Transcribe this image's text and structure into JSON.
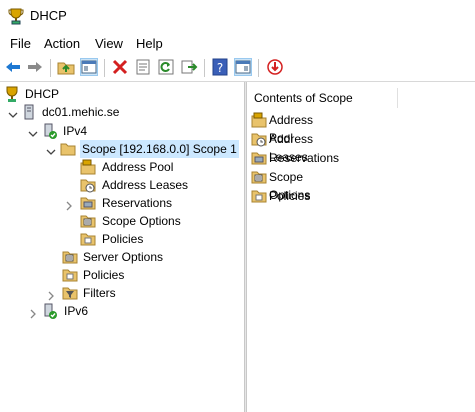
{
  "window": {
    "title": "DHCP"
  },
  "menu": [
    "File",
    "Action",
    "View",
    "Help"
  ],
  "toolbar": {
    "buttons": [
      "back-icon",
      "forward-icon",
      "up-folder-icon",
      "show-hide-tree-icon",
      "delete-icon",
      "properties-icon",
      "refresh-icon",
      "export-list-icon",
      "help-icon",
      "show-hide-action-pane-icon",
      "download-icon"
    ]
  },
  "tree": {
    "root": "DHCP",
    "server": "dc01.mehic.se",
    "ipv4": "IPv4",
    "scope": "Scope [192.168.0.0] Scope 1",
    "address_pool": "Address Pool",
    "address_leases": "Address Leases",
    "reservations": "Reservations",
    "scope_options": "Scope Options",
    "policies_scope": "Policies",
    "server_options": "Server Options",
    "policies_ipv4": "Policies",
    "filters": "Filters",
    "ipv6": "IPv6"
  },
  "content": {
    "header": "Contents of Scope",
    "items": [
      "Address Pool",
      "Address Leases",
      "Reservations",
      "Scope Options",
      "Policies"
    ]
  },
  "colors": {
    "selection": "#cce8ff",
    "folder": "#e9c36b",
    "accent": "#0078d7"
  }
}
